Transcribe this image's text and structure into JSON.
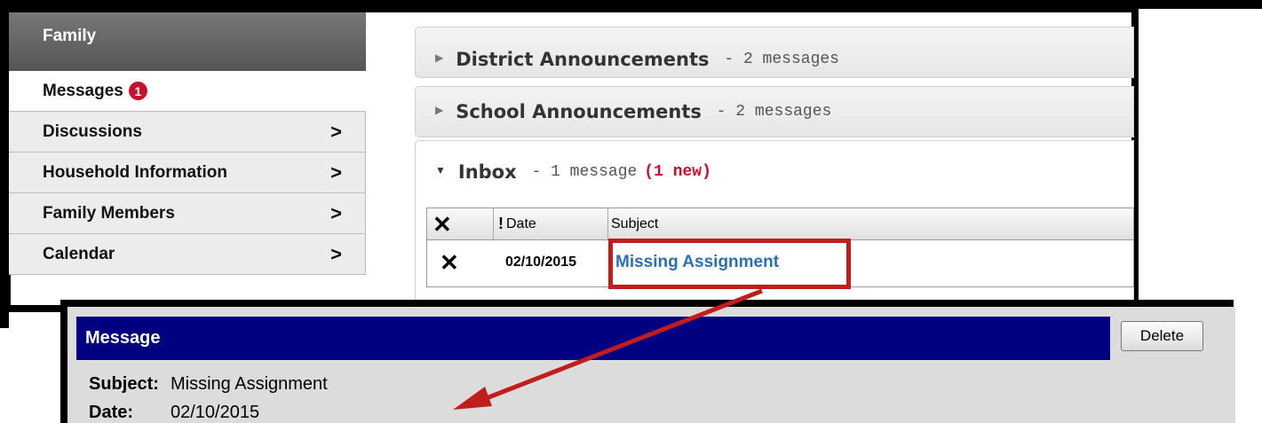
{
  "sidebar": {
    "header": "Family",
    "items": [
      {
        "label": "Messages",
        "badge": "1",
        "active": true
      },
      {
        "label": "Discussions",
        "chevron": ">"
      },
      {
        "label": "Household Information",
        "chevron": ">"
      },
      {
        "label": "Family Members",
        "chevron": ">"
      },
      {
        "label": "Calendar",
        "chevron": ">"
      }
    ]
  },
  "panels": {
    "district": {
      "title": "District Announcements",
      "count": " - 2 messages"
    },
    "school": {
      "title": "School Announcements",
      "count": " - 2 messages"
    },
    "inbox": {
      "title": "Inbox",
      "count": " - 1 message",
      "new": "(1 new)"
    }
  },
  "table": {
    "headers": {
      "date": "Date",
      "subject": "Subject"
    },
    "rows": [
      {
        "date": "02/10/2015",
        "subject": "Missing Assignment"
      }
    ]
  },
  "message": {
    "title": "Message",
    "delete_label": "Delete",
    "subject_label": "Subject:",
    "subject_value": "Missing Assignment",
    "date_label": "Date:",
    "date_value": "02/10/2015"
  },
  "colors": {
    "accent_red": "#c8102e",
    "title_bar": "#000080",
    "link": "#2b6fb5"
  }
}
